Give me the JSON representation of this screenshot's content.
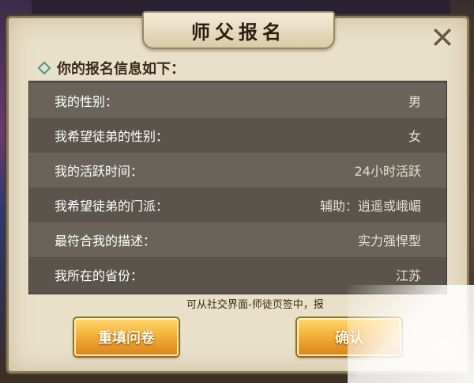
{
  "dialog": {
    "title": "师父报名",
    "heading": "你的报名信息如下："
  },
  "info_rows": [
    {
      "label": "我的性别：",
      "value": "男"
    },
    {
      "label": "我希望徒弟的性别：",
      "value": "女"
    },
    {
      "label": "我的活跃时间：",
      "value": "24小时活跃"
    },
    {
      "label": "我希望徒弟的门派：",
      "value": "辅助：逍遥或峨嵋"
    },
    {
      "label": "最符合我的描述：",
      "value": "实力强悍型"
    },
    {
      "label": "我所在的省份：",
      "value": "江苏"
    }
  ],
  "note": "可从社交界面-师徒页签中，报",
  "buttons": {
    "refill": "重填问卷",
    "confirm": "确认"
  },
  "icons": {
    "close": "close-icon",
    "heading_marker": "diamond-icon"
  }
}
